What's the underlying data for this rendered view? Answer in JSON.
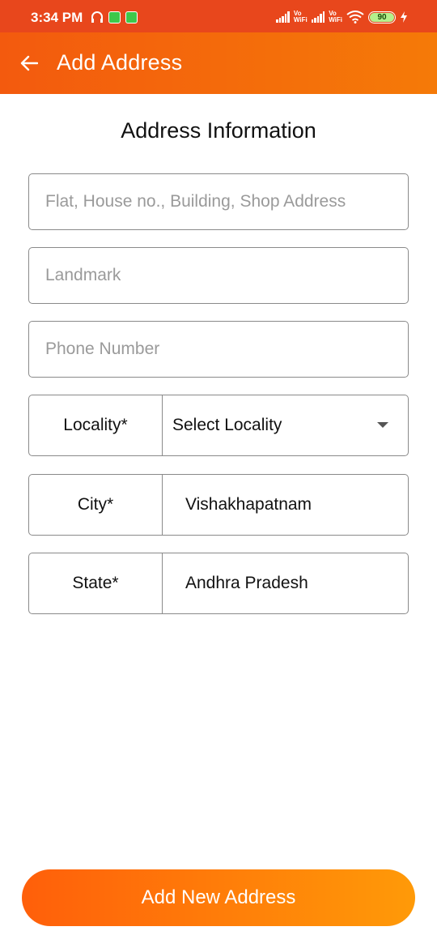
{
  "status_bar": {
    "time": "3:34 PM",
    "vowifi_top": "Vo",
    "vowifi_bottom": "WiFi",
    "battery": "90",
    "background": "#e8471c"
  },
  "app_bar": {
    "title": "Add Address",
    "back_icon": "arrow-left-icon",
    "gradient_start": "#f35a0e",
    "gradient_end": "#f57a08"
  },
  "form": {
    "section_title": "Address Information",
    "address_placeholder": "Flat, House no., Building, Shop Address",
    "address_value": "",
    "landmark_placeholder": "Landmark",
    "landmark_value": "",
    "phone_placeholder": "Phone Number",
    "phone_value": "",
    "locality_label": "Locality*",
    "locality_value": "Select Locality",
    "city_label": "City*",
    "city_value": "Vishakhapatnam",
    "state_label": "State*",
    "state_value": "Andhra Pradesh"
  },
  "submit": {
    "label": "Add New Address",
    "gradient_start": "#ff5f0a",
    "gradient_end": "#ff9a08"
  }
}
